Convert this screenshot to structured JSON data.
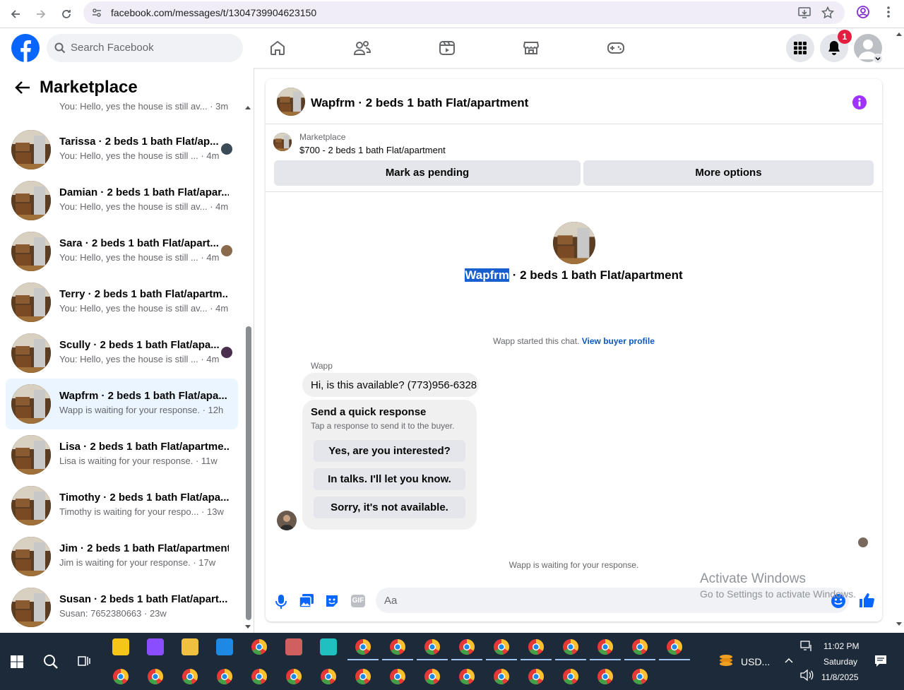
{
  "browser": {
    "url": "facebook.com/messages/t/1304739904623150"
  },
  "header": {
    "search_placeholder": "Search Facebook",
    "notification_count": "1"
  },
  "sidebar": {
    "title": "Marketplace",
    "top_partial": {
      "preview": "You: Hello, yes the house is still av...",
      "time": "· 3m"
    },
    "conversations": [
      {
        "name": "Tarissa · 2 beds 1 bath Flat/ap...",
        "preview": "You: Hello, yes the house is still ...",
        "time": "· 4m",
        "avatar": "#3a4a57"
      },
      {
        "name": "Damian · 2 beds 1 bath Flat/apar...",
        "preview": "You: Hello, yes the house is still av...",
        "time": "· 4m",
        "avatar": ""
      },
      {
        "name": "Sara · 2 beds 1 bath Flat/apart...",
        "preview": "You: Hello, yes the house is still ...",
        "time": "· 4m",
        "avatar": "#8a6a4a"
      },
      {
        "name": "Terry · 2 beds 1 bath Flat/apartm...",
        "preview": "You: Hello, yes the house is still av...",
        "time": "· 4m",
        "avatar": ""
      },
      {
        "name": "Scully · 2 beds 1 bath Flat/apa...",
        "preview": "You: Hello, yes the house is still ...",
        "time": "· 4m",
        "avatar": "#4a2f4f"
      },
      {
        "name": "Wapfrm · 2 beds 1 bath Flat/apa...",
        "preview": "Wapp is waiting for your response.",
        "time": "· 12h",
        "avatar": "",
        "selected": true
      },
      {
        "name": "Lisa · 2 beds 1 bath Flat/apartme...",
        "preview": "Lisa is waiting for your response.",
        "time": "· 11w",
        "avatar": ""
      },
      {
        "name": "Timothy · 2 beds 1 bath Flat/apa...",
        "preview": "Timothy is waiting for your respo...",
        "time": "· 13w",
        "avatar": ""
      },
      {
        "name": "Jim · 2 beds 1 bath Flat/apartment",
        "preview": "Jim is waiting for your response.",
        "time": "· 17w",
        "avatar": ""
      },
      {
        "name": "Susan · 2 beds 1 bath Flat/apart...",
        "preview": "Susan: 7652380663",
        "time": "· 23w",
        "avatar": ""
      }
    ]
  },
  "chat": {
    "title": "Wapfrm · 2 beds 1 bath Flat/apartment",
    "marketplace_label": "Marketplace",
    "listing": "$700 - 2 beds 1 bath Flat/apartment",
    "mark_pending": "Mark as pending",
    "more_options": "More options",
    "center_title_highlight": "Wapfrm",
    "center_title_rest": " · 2 beds 1 bath Flat/apartment",
    "started_text": "Wapp started this chat.",
    "view_profile": "View buyer profile",
    "sender": "Wapp",
    "message": "Hi, is this available? (773)956-6328",
    "quick_title": "Send a quick response",
    "quick_sub": "Tap a response to send it to the buyer.",
    "quick_replies": [
      "Yes, are you interested?",
      "In talks. I'll let you know.",
      "Sorry, it's not available."
    ],
    "waiting": "Wapp is waiting for your response.",
    "compose_placeholder": "Aa",
    "gif_label": "GIF"
  },
  "watermark": {
    "line1": "Activate Windows",
    "line2": "Go to Settings to activate Windows."
  },
  "taskbar": {
    "currency": "USD...",
    "time": "11:02 PM",
    "day": "Saturday",
    "date": "11/8/2025"
  },
  "colors": {
    "fb_blue": "#0866ff",
    "selected_bg": "#ebf5ff",
    "purple": "#a033ff"
  }
}
